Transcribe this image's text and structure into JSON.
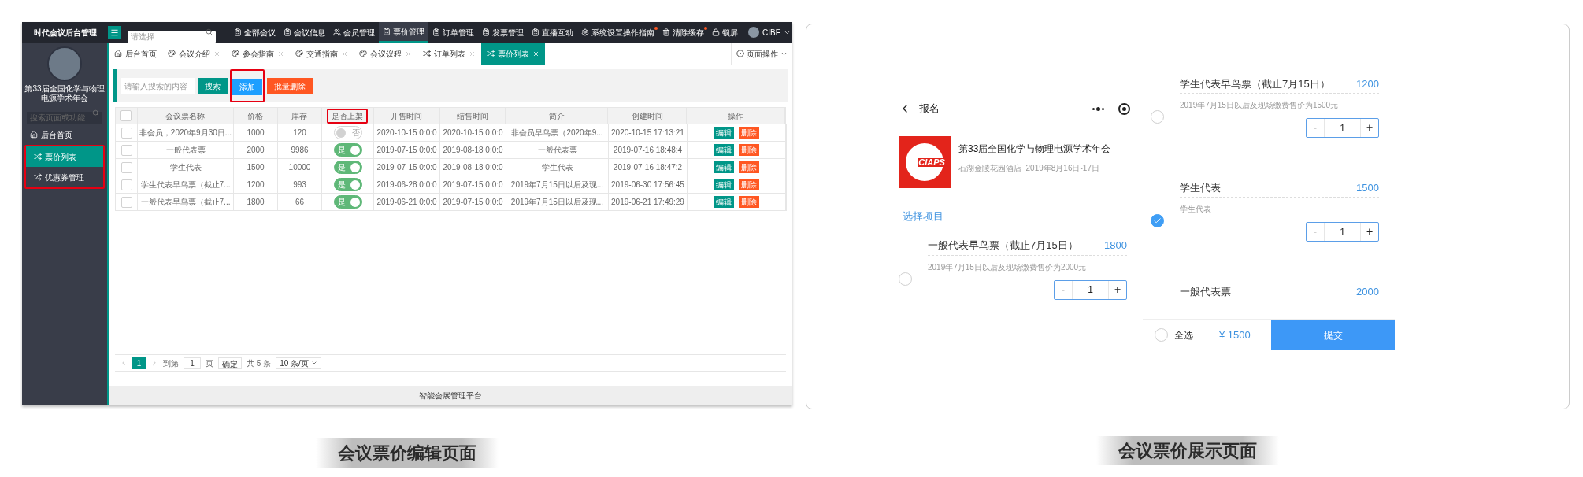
{
  "admin": {
    "logo": "时代会议后台管理",
    "top_search": {
      "placeholder": "请选择"
    },
    "nav": [
      {
        "label": "全部会议",
        "selected": false,
        "dot": false
      },
      {
        "label": "会议信息",
        "selected": false,
        "dot": false
      },
      {
        "label": "会员管理",
        "selected": false,
        "dot": false
      },
      {
        "label": "票价管理",
        "selected": true,
        "dot": false
      },
      {
        "label": "订单管理",
        "selected": false,
        "dot": false
      },
      {
        "label": "发票管理",
        "selected": false,
        "dot": false
      },
      {
        "label": "直播互动",
        "selected": false,
        "dot": false
      },
      {
        "label": "系统设置操作指南",
        "selected": false,
        "dot": true
      },
      {
        "label": "清除缓存",
        "selected": false,
        "dot": true
      },
      {
        "label": "锁屏",
        "selected": false,
        "dot": false
      }
    ],
    "user": {
      "name": "CIBF"
    },
    "sidebar": {
      "conference": "第33届全国化学与物理电源学术年会",
      "search": {
        "placeholder": "搜索页面或功能"
      },
      "items": [
        {
          "label": "后台首页",
          "selected": false,
          "highlighted": false
        },
        {
          "label": "票价列表",
          "selected": true,
          "highlighted": true
        },
        {
          "label": "优惠券管理",
          "selected": false,
          "highlighted": true
        }
      ]
    },
    "tabs": [
      {
        "label": "后台首页",
        "selected": false,
        "closable": false
      },
      {
        "label": "会议介绍",
        "selected": false,
        "closable": true
      },
      {
        "label": "参会指南",
        "selected": false,
        "closable": true
      },
      {
        "label": "交通指南",
        "selected": false,
        "closable": true
      },
      {
        "label": "会议议程",
        "selected": false,
        "closable": true
      },
      {
        "label": "订单列表",
        "selected": false,
        "closable": true
      },
      {
        "label": "票价列表",
        "selected": true,
        "closable": true
      }
    ],
    "page_actions": "页面操作",
    "toolbar": {
      "search": {
        "placeholder": "请输入搜索的内容"
      },
      "buttons": [
        {
          "label": "搜索",
          "kind": "search",
          "highlighted": false
        },
        {
          "label": "添加",
          "kind": "add",
          "highlighted": true
        },
        {
          "label": "批量删除",
          "kind": "delete",
          "highlighted": false
        }
      ]
    },
    "table": {
      "header_checked": false,
      "columns": [
        {
          "label": "会议票名称",
          "highlighted": false
        },
        {
          "label": "价格",
          "highlighted": false
        },
        {
          "label": "库存",
          "highlighted": false
        },
        {
          "label": "是否上架",
          "highlighted": true
        },
        {
          "label": "开售时间",
          "highlighted": false
        },
        {
          "label": "结售时间",
          "highlighted": false
        },
        {
          "label": "简介",
          "highlighted": false
        },
        {
          "label": "创建时间",
          "highlighted": false
        },
        {
          "label": "操作",
          "highlighted": false
        }
      ],
      "rows": [
        {
          "checked": false,
          "name": "非会员，2020年9月30日...",
          "price": "1000",
          "stock": "120",
          "listed": {
            "on": false,
            "label": "否"
          },
          "start": "2020-10-15 0:0:0",
          "end": "2020-10-15 0:0:0",
          "intro": "非会员早鸟票（2020年9...",
          "created": "2020-10-15 17:13:21",
          "actions": [
            "编辑",
            "删除"
          ]
        },
        {
          "checked": false,
          "name": "一般代表票",
          "price": "2000",
          "stock": "9986",
          "listed": {
            "on": true,
            "label": "是"
          },
          "start": "2019-07-15 0:0:0",
          "end": "2019-08-18 0:0:0",
          "intro": "一般代表票",
          "created": "2019-07-16 18:48:4",
          "actions": [
            "编辑",
            "删除"
          ]
        },
        {
          "checked": false,
          "name": "学生代表",
          "price": "1500",
          "stock": "10000",
          "listed": {
            "on": true,
            "label": "是"
          },
          "start": "2019-07-15 0:0:0",
          "end": "2019-08-18 0:0:0",
          "intro": "学生代表",
          "created": "2019-07-16 18:47:2",
          "actions": [
            "编辑",
            "删除"
          ]
        },
        {
          "checked": false,
          "name": "学生代表早鸟票（截止7...",
          "price": "1200",
          "stock": "993",
          "listed": {
            "on": true,
            "label": "是"
          },
          "start": "2019-06-28 0:0:0",
          "end": "2019-07-15 0:0:0",
          "intro": "2019年7月15日以后及现...",
          "created": "2019-06-30 17:56:45",
          "actions": [
            "编辑",
            "删除"
          ]
        },
        {
          "checked": false,
          "name": "一般代表早鸟票（截止7...",
          "price": "1800",
          "stock": "66",
          "listed": {
            "on": true,
            "label": "是"
          },
          "start": "2019-06-21 0:0:0",
          "end": "2019-07-15 0:0:0",
          "intro": "2019年7月15日以后及现...",
          "created": "2019-06-21 17:49:29",
          "actions": [
            "编辑",
            "删除"
          ]
        }
      ]
    },
    "pagination": {
      "pages": [
        {
          "label": "1",
          "selected": true
        }
      ],
      "goto_label": "到第",
      "goto_value": "1",
      "page_unit": "页",
      "confirm": "确定",
      "total": "共 5 条",
      "page_size": "10 条/页"
    },
    "footer": "智能会展管理平台",
    "caption": "会议票价编辑页面"
  },
  "mobile": {
    "header": {
      "title": "报名"
    },
    "conference": {
      "logo_text": "CIAPS",
      "title": "第33届全国化学与物理电源学术年会",
      "subtitle": "石湖金陵花园酒店  2019年8月16日-17日"
    },
    "section_title": "选择项目",
    "tickets": [
      {
        "name": "一般代表早鸟票（截止7月15日）",
        "price": "1800",
        "description": "2019年7月15日以后及现场缴费售价为2000元",
        "checked": false,
        "stepper": {
          "minus": "-",
          "value": "1",
          "plus": "+"
        }
      },
      {
        "name": "学生代表早鸟票（截止7月15日）",
        "price": "1200",
        "description": "2019年7月15日以后及现场缴费售价为1500元",
        "checked": false,
        "stepper": {
          "minus": "-",
          "value": "1",
          "plus": "+"
        }
      },
      {
        "name": "学生代表",
        "price": "1500",
        "description": "学生代表",
        "checked": true,
        "stepper": {
          "minus": "-",
          "value": "1",
          "plus": "+"
        }
      },
      {
        "name": "一般代表票",
        "price": "2000"
      }
    ],
    "footer": {
      "select_all": {
        "label": "全选",
        "checked": false
      },
      "total": "¥ 1500",
      "submit": "提交"
    },
    "caption": "会议票价展示页面"
  }
}
